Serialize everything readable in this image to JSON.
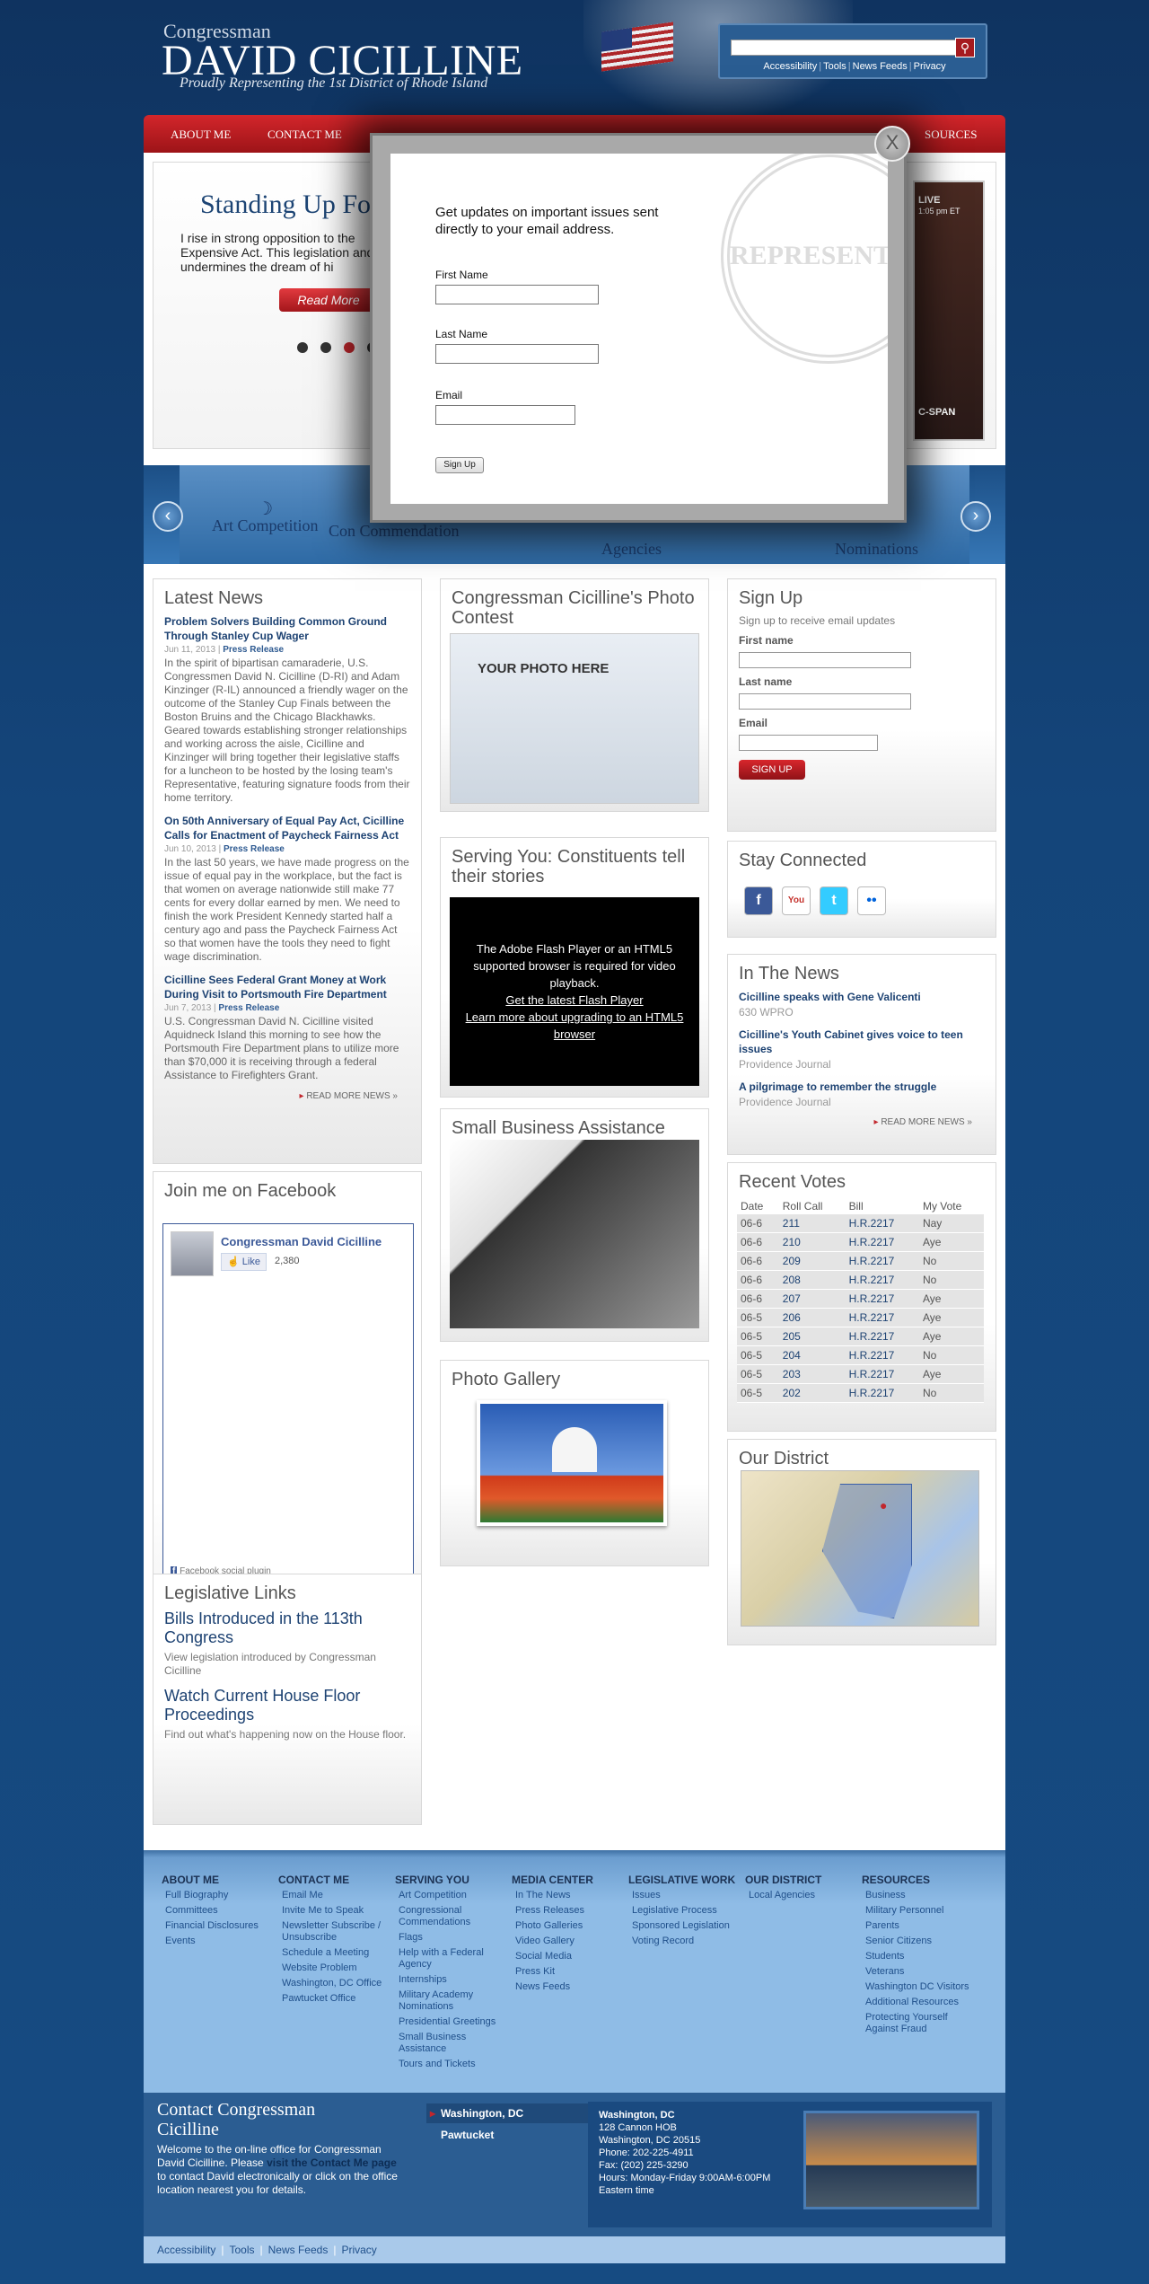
{
  "header": {
    "small": "Congressman",
    "big": "DAVID CICILLINE",
    "tagline": "Proudly Representing the 1st District of Rhode Island",
    "utility": [
      "Accessibility",
      "Tools",
      "News Feeds",
      "Privacy"
    ]
  },
  "nav": {
    "items": [
      "ABOUT ME",
      "CONTACT ME",
      "SOURCES"
    ]
  },
  "slider": {
    "title": "Standing Up Fo",
    "text": "I rise in strong opposition to the Expensive Act. This legislation and undermines the dream of hi",
    "read_more": "Read More",
    "live": "LIVE",
    "live_time": "1:05 pm ET",
    "network": "C-SPAN"
  },
  "strip": {
    "items": [
      {
        "label": "Art Competition"
      },
      {
        "label": "Con Commendation"
      },
      {
        "label": "Agencies"
      },
      {
        "label": "Nominations"
      }
    ]
  },
  "latest_news": {
    "title": "Latest News",
    "items": [
      {
        "headline": "Problem Solvers Building Common Ground Through Stanley Cup Wager",
        "date": "Jun 11, 2013",
        "type": "Press Release",
        "body": "In the spirit of bipartisan camaraderie, U.S. Congressmen David N. Cicilline (D-RI) and Adam Kinzinger (R-IL) announced a friendly wager on the outcome of the Stanley Cup Finals between the Boston Bruins and the Chicago Blackhawks. Geared towards establishing stronger relationships and working across the aisle, Cicilline and Kinzinger will bring together their legislative staffs for a luncheon to be hosted by the losing team's Representative, featuring signature foods from their home territory."
      },
      {
        "headline": "On 50th Anniversary of Equal Pay Act, Cicilline Calls for Enactment of Paycheck Fairness Act",
        "date": "Jun 10, 2013",
        "type": "Press Release",
        "body": "In the last 50 years, we have made progress on the issue of equal pay in the workplace, but the fact is that women on average nationwide still make 77 cents for every dollar earned by men. We need to finish the work President Kennedy started half a century ago and pass the Paycheck Fairness Act so that women have the tools they need to fight wage discrimination."
      },
      {
        "headline": "Cicilline Sees Federal Grant Money at Work During Visit to Portsmouth Fire Department",
        "date": "Jun 7, 2013",
        "type": "Press Release",
        "body": "U.S. Congressman David N. Cicilline visited Aquidneck Island this morning to see how the Portsmouth Fire Department plans to utilize more than $70,000 it is receiving through a federal Assistance to Firefighters Grant."
      }
    ],
    "more": "READ MORE NEWS »"
  },
  "facebook": {
    "title": "Join me on Facebook",
    "page_name": "Congressman David Cicilline",
    "like": "Like",
    "count": "2,380",
    "plugin": "Facebook social plugin"
  },
  "legislative": {
    "title": "Legislative Links",
    "links": [
      {
        "title": "Bills Introduced in the 113th Congress",
        "desc": "View legislation introduced by Congressman Cicilline"
      },
      {
        "title": "Watch Current House Floor Proceedings",
        "desc": "Find out what's happening now on the House floor."
      }
    ]
  },
  "photo_contest": {
    "title": "Congressman Cicilline's Photo Contest",
    "banner": "YOUR PHOTO HERE"
  },
  "serving": {
    "title": "Serving You: Constituents tell their stories",
    "flash_text": "The Adobe Flash Player or an HTML5 supported browser is required for video playback.",
    "flash_link1": "Get the latest Flash Player",
    "flash_link2": "Learn more about upgrading to an HTML5 browser"
  },
  "small_business": {
    "title": "Small Business Assistance"
  },
  "photo_gallery": {
    "title": "Photo Gallery"
  },
  "signup": {
    "title": "Sign Up",
    "sub": "Sign up to receive email updates",
    "first": "First name",
    "last": "Last name",
    "email": "Email",
    "button": "SIGN UP"
  },
  "stay_connected": {
    "title": "Stay Connected",
    "icons": [
      "facebook-icon",
      "youtube-icon",
      "twitter-icon",
      "flickr-icon"
    ]
  },
  "in_the_news": {
    "title": "In The News",
    "items": [
      {
        "headline": "Cicilline speaks with Gene Valicenti",
        "source": "630 WPRO"
      },
      {
        "headline": "Cicilline's Youth Cabinet gives voice to teen issues",
        "source": "Providence Journal"
      },
      {
        "headline": "A pilgrimage to remember the struggle",
        "source": "Providence Journal"
      }
    ],
    "more": "READ MORE NEWS »"
  },
  "recent_votes": {
    "title": "Recent Votes",
    "headers": [
      "Date",
      "Roll Call",
      "Bill",
      "My Vote"
    ],
    "rows": [
      [
        "06-6",
        "211",
        "H.R.2217",
        "Nay"
      ],
      [
        "06-6",
        "210",
        "H.R.2217",
        "Aye"
      ],
      [
        "06-6",
        "209",
        "H.R.2217",
        "No"
      ],
      [
        "06-6",
        "208",
        "H.R.2217",
        "No"
      ],
      [
        "06-6",
        "207",
        "H.R.2217",
        "Aye"
      ],
      [
        "06-5",
        "206",
        "H.R.2217",
        "Aye"
      ],
      [
        "06-5",
        "205",
        "H.R.2217",
        "Aye"
      ],
      [
        "06-5",
        "204",
        "H.R.2217",
        "No"
      ],
      [
        "06-5",
        "203",
        "H.R.2217",
        "Aye"
      ],
      [
        "06-5",
        "202",
        "H.R.2217",
        "No"
      ]
    ]
  },
  "our_district": {
    "title": "Our District"
  },
  "footer": {
    "columns": [
      {
        "heading": "ABOUT ME",
        "items": [
          "Full Biography",
          "Committees",
          "Financial Disclosures",
          "Events"
        ]
      },
      {
        "heading": "CONTACT ME",
        "items": [
          "Email Me",
          "Invite Me to Speak",
          "Newsletter Subscribe / Unsubscribe",
          "Schedule a Meeting",
          "Website Problem",
          "Washington, DC Office",
          "Pawtucket Office"
        ]
      },
      {
        "heading": "SERVING YOU",
        "items": [
          "Art Competition",
          "Congressional Commendations",
          "Flags",
          "Help with a Federal Agency",
          "Internships",
          "Military Academy Nominations",
          "Presidential Greetings",
          "Small Business Assistance",
          "Tours and Tickets"
        ]
      },
      {
        "heading": "MEDIA CENTER",
        "items": [
          "In The News",
          "Press Releases",
          "Photo Galleries",
          "Video Gallery",
          "Social Media",
          "Press Kit",
          "News Feeds"
        ]
      },
      {
        "heading": "LEGISLATIVE WORK",
        "items": [
          "Issues",
          "Legislative Process",
          "Sponsored Legislation",
          "Voting Record"
        ]
      },
      {
        "heading": "OUR DISTRICT",
        "items": [
          "Local Agencies"
        ]
      },
      {
        "heading": "RESOURCES",
        "items": [
          "Business",
          "Military Personnel",
          "Parents",
          "Senior Citizens",
          "Students",
          "Veterans",
          "Washington DC Visitors",
          "Additional Resources",
          "Protecting Yourself Against Fraud"
        ]
      }
    ]
  },
  "contact": {
    "title": "Contact Congressman Cicilline",
    "text_before": "Welcome to the on-line office for Congressman David Cicilline. Please ",
    "link": "visit the Contact Me page",
    "text_after": " to contact David electronically or click on the office location nearest you for details.",
    "tabs": [
      "Washington, DC",
      "Pawtucket"
    ],
    "office_name": "Washington, DC",
    "office_lines": [
      "128 Cannon HOB",
      "Washington, DC 20515",
      "Phone: 202-225-4911",
      "Fax: (202) 225-3290",
      "Hours: Monday-Friday 9:00AM-6:00PM",
      "Eastern time"
    ]
  },
  "bottom": {
    "links": [
      "Accessibility",
      "Tools",
      "News Feeds",
      "Privacy"
    ]
  },
  "modal": {
    "text": "Get updates on important issues sent directly to your email address.",
    "first": "First Name",
    "last": "Last Name",
    "email": "Email",
    "button": "Sign Up",
    "close": "X",
    "seal": "REPRESENTATIVES"
  },
  "colors": {
    "brand_red": "#c1272d",
    "brand_blue": "#1d4272",
    "background": "#14457a"
  }
}
